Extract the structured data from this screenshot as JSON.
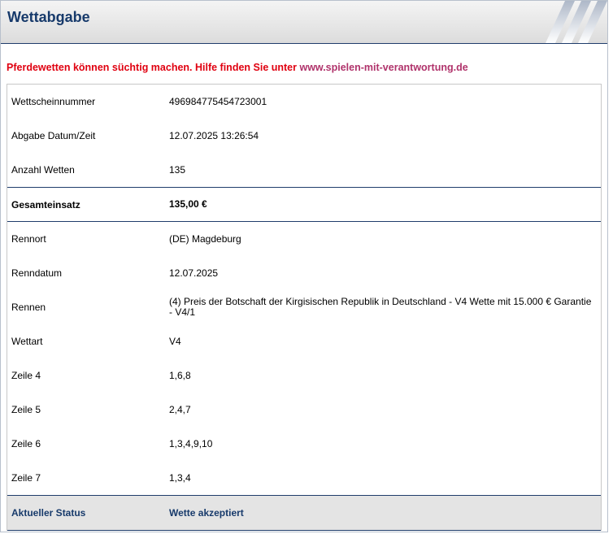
{
  "header": {
    "title": "Wettabgabe"
  },
  "warning": {
    "text": "Pferdewetten können süchtig machen. Hilfe finden Sie unter ",
    "link": "www.spielen-mit-verantwortung.de",
    "text_color": "#e00010",
    "link_color": "#b0336b"
  },
  "ticket": {
    "number_label": "Wettscheinnummer",
    "number_value": "496984775454723001",
    "date_label": "Abgabe Datum/Zeit",
    "date_value": "12.07.2025 13:26:54",
    "count_label": "Anzahl Wetten",
    "count_value": "135"
  },
  "total": {
    "label": "Gesamteinsatz",
    "value": "135,00 €"
  },
  "race": {
    "venue_label": "Rennort",
    "venue_value": "(DE) Magdeburg",
    "date_label": "Renndatum",
    "date_value": "12.07.2025",
    "race_label": "Rennen",
    "race_value": "(4) Preis der Botschaft der Kirgisischen Republik in Deutschland - V4 Wette mit 15.000 € Garantie - V4/1",
    "bettype_label": "Wettart",
    "bettype_value": "V4"
  },
  "lines": [
    {
      "label": "Zeile 4",
      "value": "1,6,8"
    },
    {
      "label": "Zeile 5",
      "value": "2,4,7"
    },
    {
      "label": "Zeile 6",
      "value": "1,3,4,9,10"
    },
    {
      "label": "Zeile 7",
      "value": "1,3,4"
    }
  ],
  "status": {
    "label": "Aktueller Status",
    "value": "Wette akzeptiert",
    "color": "#173a6b"
  }
}
